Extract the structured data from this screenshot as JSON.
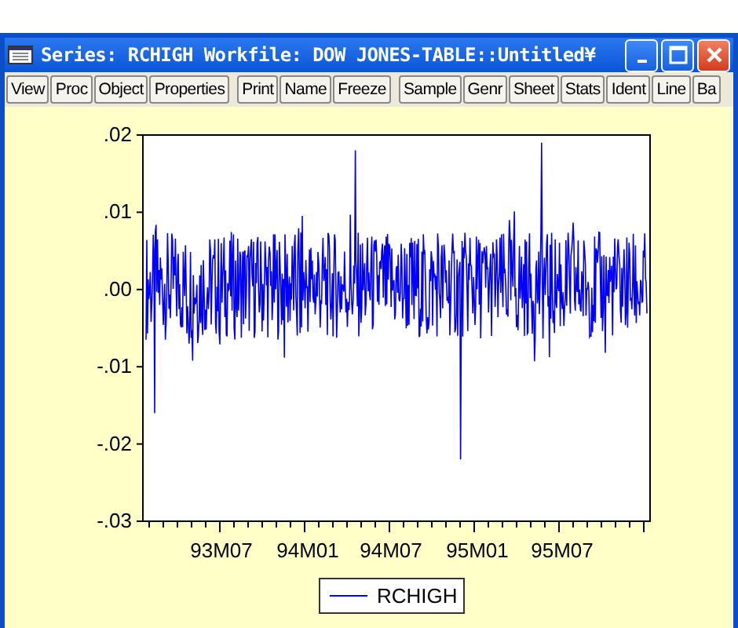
{
  "window": {
    "title": "Series: RCHIGH   Workfile: DOW JONES-TABLE::Untitled¥"
  },
  "toolbar": [
    [
      "View",
      "Proc",
      "Object",
      "Properties"
    ],
    [
      "Print",
      "Name",
      "Freeze"
    ],
    [
      "Sample",
      "Genr",
      "Sheet",
      "Stats",
      "Ident",
      "Line",
      "Ba"
    ]
  ],
  "graph": {
    "y_ticks": [
      ".02",
      ".01",
      ".00",
      "-.01",
      "-.02",
      "-.03"
    ],
    "x_ticks": [
      "93M07",
      "94M01",
      "94M07",
      "95M01",
      "95M07"
    ],
    "legend": "RCHIGH"
  }
}
